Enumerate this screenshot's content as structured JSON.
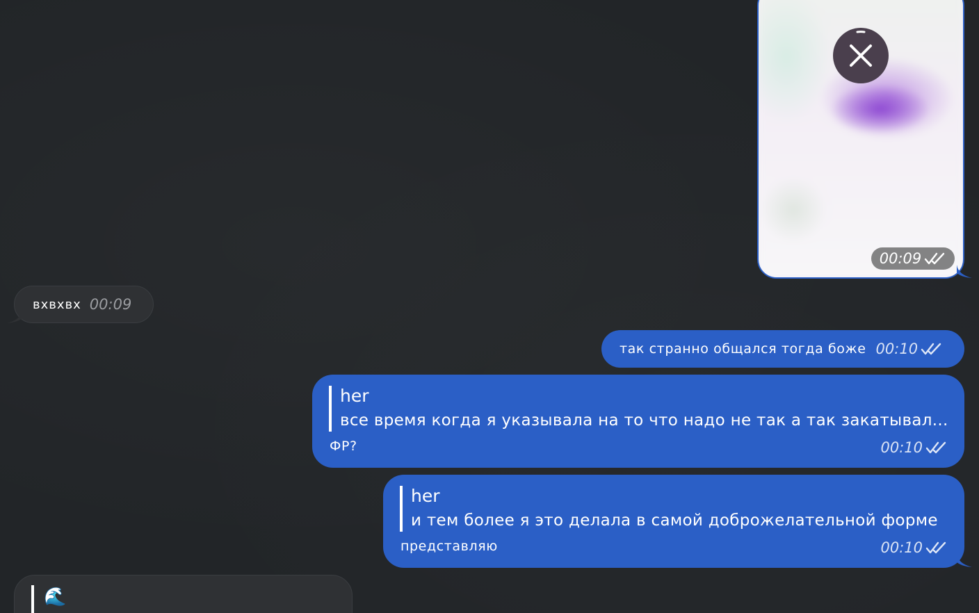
{
  "colors": {
    "background": "#222528",
    "outgoing_bubble": "#2b5fc6",
    "incoming_bubble": "#2f3134"
  },
  "messages": {
    "photo": {
      "time": "00:09",
      "status_icon": "double-check-icon",
      "overlay_icon": "close-icon"
    },
    "incoming_1": {
      "text": "вхвхвх",
      "time": "00:09"
    },
    "outgoing_1": {
      "text": "так странно общался тогда боже",
      "time": "00:10",
      "status_icon": "double-check-icon"
    },
    "outgoing_2": {
      "reply_name": "her",
      "reply_text": "все время когда я указывала на то что надо не так а так закатывал...",
      "text": "ФР?",
      "time": "00:10",
      "status_icon": "double-check-icon"
    },
    "outgoing_3": {
      "reply_name": "her",
      "reply_text": "и тем более я это делала в самой доброжелательной форме",
      "text": "представляю",
      "time": "00:10",
      "status_icon": "double-check-icon"
    },
    "incoming_2": {
      "reply_emoji": "🌊"
    }
  }
}
